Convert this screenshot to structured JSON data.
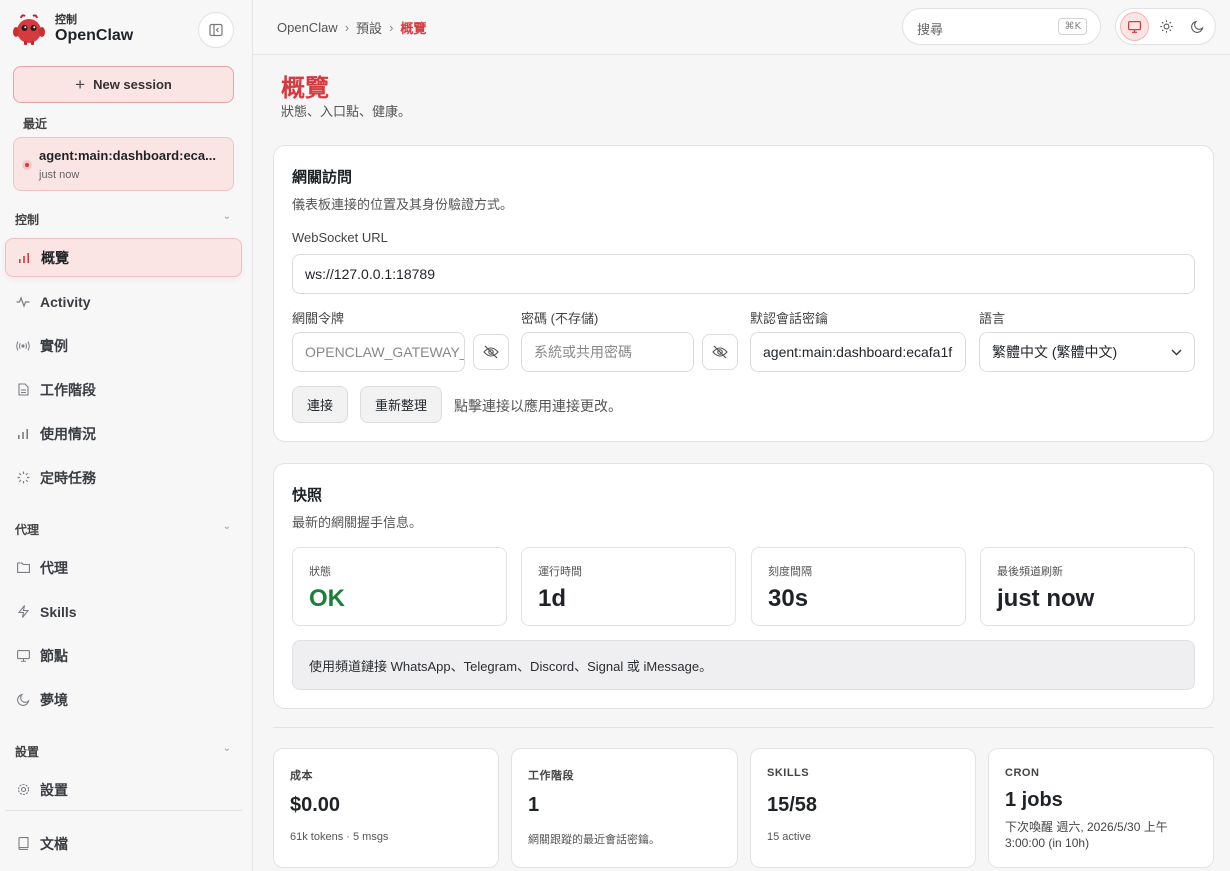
{
  "brand": {
    "subtitle": "控制",
    "title": "OpenClaw"
  },
  "sidebar": {
    "new_session": "New session",
    "recent_label": "最近",
    "recent": {
      "title": "agent:main:dashboard:eca...",
      "time": "just now"
    },
    "sections": {
      "control": "控制",
      "agents": "代理",
      "settings": "設置"
    },
    "items": {
      "overview": "概覽",
      "activity": "Activity",
      "instances": "實例",
      "sessions": "工作階段",
      "usage": "使用情況",
      "cron": "定時任務",
      "agents": "代理",
      "skills": "Skills",
      "nodes": "節點",
      "dreams": "夢境",
      "settings": "設置",
      "docs": "文檔"
    }
  },
  "topbar": {
    "breadcrumb": [
      "OpenClaw",
      "預設",
      "概覽"
    ],
    "search_placeholder": "搜尋",
    "search_shortcut": "⌘K"
  },
  "page": {
    "title": "概覽",
    "subtitle": "狀態、入口點、健康。"
  },
  "gateway": {
    "title": "網關訪問",
    "subtitle": "儀表板連接的位置及其身份驗證方式。",
    "ws_label": "WebSocket URL",
    "ws_value": "ws://127.0.0.1:18789",
    "token_label": "網關令牌",
    "token_placeholder": "OPENCLAW_GATEWAY_TOKEN",
    "password_label": "密碼 (不存儲)",
    "password_placeholder": "系統或共用密碼",
    "session_key_label": "默認會話密鑰",
    "session_key_value": "agent:main:dashboard:ecafa1f",
    "language_label": "語言",
    "language_value": "繁體中文 (繁體中文)",
    "connect": "連接",
    "refresh": "重新整理",
    "hint": "點擊連接以應用連接更改。"
  },
  "snapshot": {
    "title": "快照",
    "subtitle": "最新的網關握手信息。",
    "stats": [
      {
        "label": "狀態",
        "value": "OK"
      },
      {
        "label": "運行時間",
        "value": "1d"
      },
      {
        "label": "刻度間隔",
        "value": "30s"
      },
      {
        "label": "最後頻道刷新",
        "value": "just now"
      }
    ],
    "callout": "使用頻道鏈接 WhatsApp、Telegram、Discord、Signal 或 iMessage。"
  },
  "summary": [
    {
      "label": "成本",
      "value": "$0.00",
      "foot": "61k tokens · 5 msgs"
    },
    {
      "label": "工作階段",
      "value": "1",
      "foot": "網關跟蹤的最近會話密鑰。"
    },
    {
      "label": "SKILLS",
      "value": "15/58",
      "foot": "15 active"
    },
    {
      "label": "CRON",
      "value": "1 jobs",
      "foot": "下次喚醒 週六, 2026/5/30 上午 3:00:00 (in 10h)"
    }
  ],
  "colors": {
    "accent": "#d63a3f",
    "accent_bg": "#fbe4e4",
    "ok": "#1a7f37"
  }
}
